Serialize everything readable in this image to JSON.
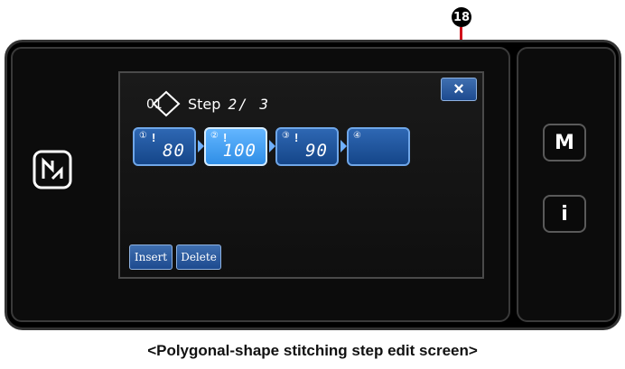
{
  "callout": {
    "label": "18"
  },
  "screen": {
    "step_label": "Step",
    "step_count": "2/ 3",
    "step_icon_text": "01",
    "close_label": "×",
    "steps": [
      {
        "num": "①",
        "value": "80",
        "selected": false
      },
      {
        "num": "②",
        "value": "100",
        "selected": true
      },
      {
        "num": "③",
        "value": "90",
        "selected": false
      },
      {
        "num": "④",
        "value": "",
        "selected": false
      }
    ],
    "insert_label": "Insert",
    "delete_label": "Delete"
  },
  "side": {
    "m_label": "M",
    "i_label": "i"
  },
  "icons": {
    "nfc": "nfc-icon",
    "needle": "needle-icon",
    "step": "step-diamond-icon"
  },
  "caption": "<Polygonal-shape stitching step edit screen>"
}
